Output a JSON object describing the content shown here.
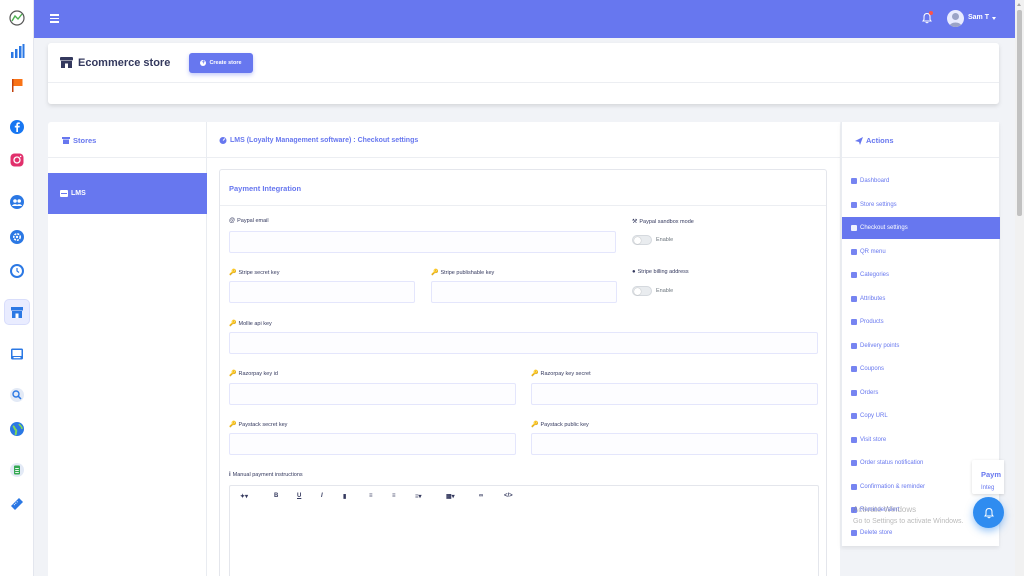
{
  "topbar": {
    "user_name": "Sam T"
  },
  "header": {
    "title": "Ecommerce store",
    "create_button": "Create store"
  },
  "stores": {
    "title": "Stores",
    "items": [
      {
        "label": "LMS",
        "active": true
      }
    ]
  },
  "main": {
    "title": "LMS (Loyalty Management software) : Checkout settings",
    "section_title": "Payment Integration",
    "fields": {
      "paypal_email": {
        "label": "Paypal email",
        "value": ""
      },
      "paypal_sandbox": {
        "label": "Paypal sandbox mode",
        "toggle_label": "Enable"
      },
      "stripe_secret": {
        "label": "Stripe secret key",
        "value": ""
      },
      "stripe_publishable": {
        "label": "Stripe publishable key",
        "value": ""
      },
      "stripe_billing": {
        "label": "Stripe billing address",
        "toggle_label": "Enable"
      },
      "mollie_key": {
        "label": "Mollie api key",
        "value": ""
      },
      "razorpay_id": {
        "label": "Razorpay key id",
        "value": ""
      },
      "razorpay_secret": {
        "label": "Razorpay key secret",
        "value": ""
      },
      "paystack_secret": {
        "label": "Paystack secret key",
        "value": ""
      },
      "paystack_public": {
        "label": "Paystack public key",
        "value": ""
      },
      "manual_instructions": {
        "label": "Manual payment instructions"
      }
    }
  },
  "actions": {
    "title": "Actions",
    "items": [
      {
        "label": "Dashboard"
      },
      {
        "label": "Store settings"
      },
      {
        "label": "Checkout settings",
        "active": true
      },
      {
        "label": "QR menu"
      },
      {
        "label": "Categories"
      },
      {
        "label": "Attributes"
      },
      {
        "label": "Products"
      },
      {
        "label": "Delivery points"
      },
      {
        "label": "Coupons"
      },
      {
        "label": "Orders"
      },
      {
        "label": "Copy URL"
      },
      {
        "label": "Visit store"
      },
      {
        "label": "Order status notification"
      },
      {
        "label": "Confirmation & reminder"
      },
      {
        "label": "Reminder/alert"
      },
      {
        "label": "Delete store"
      }
    ]
  },
  "watermark": {
    "line1": "Activate Windows",
    "line2": "Go to Settings to activate Windows."
  },
  "peek": {
    "line1": "Paym",
    "line2": "Integ"
  },
  "colors": {
    "primary": "#6777ef",
    "fab": "#2f8cf0",
    "danger": "#fc544b"
  }
}
